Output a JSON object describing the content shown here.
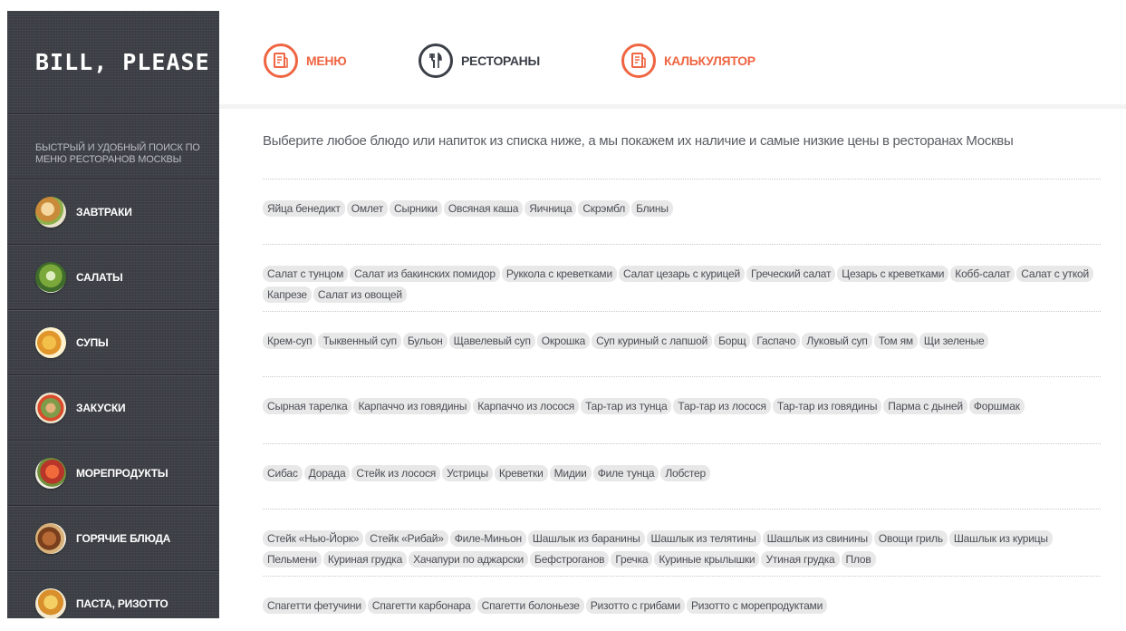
{
  "brand": {
    "logo_text": "BILL, PLEASE",
    "tagline": "БЫСТРЫЙ И УДОБНЫЙ ПОИСК ПО МЕНЮ РЕСТОРАНОВ МОСКВЫ"
  },
  "colors": {
    "accent": "#ef6542",
    "dark": "#3b3f47",
    "sidebar": "#3d4046",
    "chip_bg": "#e8e8e8"
  },
  "nav": {
    "items": [
      {
        "label": "МЕНЮ",
        "icon": "menu-card-icon"
      },
      {
        "label": "РЕСТОРАНЫ",
        "icon": "fork-knife-icon"
      },
      {
        "label": "КАЛЬКУЛЯТОР",
        "icon": "menu-card-icon"
      }
    ]
  },
  "sidebar": {
    "categories": [
      {
        "label": "ЗАВТРАКИ"
      },
      {
        "label": "САЛАТЫ"
      },
      {
        "label": "СУПЫ"
      },
      {
        "label": "ЗАКУСКИ"
      },
      {
        "label": "МОРЕПРОДУКТЫ"
      },
      {
        "label": "ГОРЯЧИЕ БЛЮДА"
      },
      {
        "label": "ПАСТА, РИЗОТТО"
      }
    ]
  },
  "main": {
    "intro": "Выберите любое блюдо или напиток из списка ниже, а мы покажем их наличие и самые низкие цены в ресторанах Москвы",
    "groups": [
      {
        "dishes": [
          "Яйца бенедикт",
          "Омлет",
          "Сырники",
          "Овсяная каша",
          "Яичница",
          "Скрэмбл",
          "Блины"
        ]
      },
      {
        "dishes": [
          "Салат с тунцом",
          "Салат из бакинских помидор",
          "Руккола с креветками",
          "Салат цезарь с курицей",
          "Греческий салат",
          "Цезарь с креветками",
          "Кобб-салат",
          "Салат с уткой",
          "Капрезе",
          "Салат из овощей"
        ]
      },
      {
        "dishes": [
          "Крем-суп",
          "Тыквенный суп",
          "Бульон",
          "Щавелевый суп",
          "Окрошка",
          "Суп куриный с лапшой",
          "Борщ",
          "Гаспачо",
          "Луковый суп",
          "Том ям",
          "Щи зеленые"
        ]
      },
      {
        "dishes": [
          "Сырная тарелка",
          "Карпаччо из говядины",
          "Карпаччо из лосося",
          "Тар-тар из тунца",
          "Тар-тар из лосося",
          "Тар-тар из говядины",
          "Парма с дыней",
          "Форшмак"
        ]
      },
      {
        "dishes": [
          "Сибас",
          "Дорада",
          "Стейк из лосося",
          "Устрицы",
          "Креветки",
          "Мидии",
          "Филе тунца",
          "Лобстер"
        ]
      },
      {
        "dishes": [
          "Стейк «Нью-Йорк»",
          "Стейк «Рибай»",
          "Филе-Миньон",
          "Шашлык из баранины",
          "Шашлык из телятины",
          "Шашлык из свинины",
          "Овощи гриль",
          "Шашлык из курицы",
          "Пельмени",
          "Куриная грудка",
          "Хачапури по аджарски",
          "Бефстроганов",
          "Гречка",
          "Куриные крылышки",
          "Утиная грудка",
          "Плов"
        ]
      },
      {
        "dishes": [
          "Спагетти фетучини",
          "Спагетти карбонара",
          "Спагетти болоньезе",
          "Ризотто с грибами",
          "Ризотто с морепродуктами"
        ]
      }
    ]
  }
}
